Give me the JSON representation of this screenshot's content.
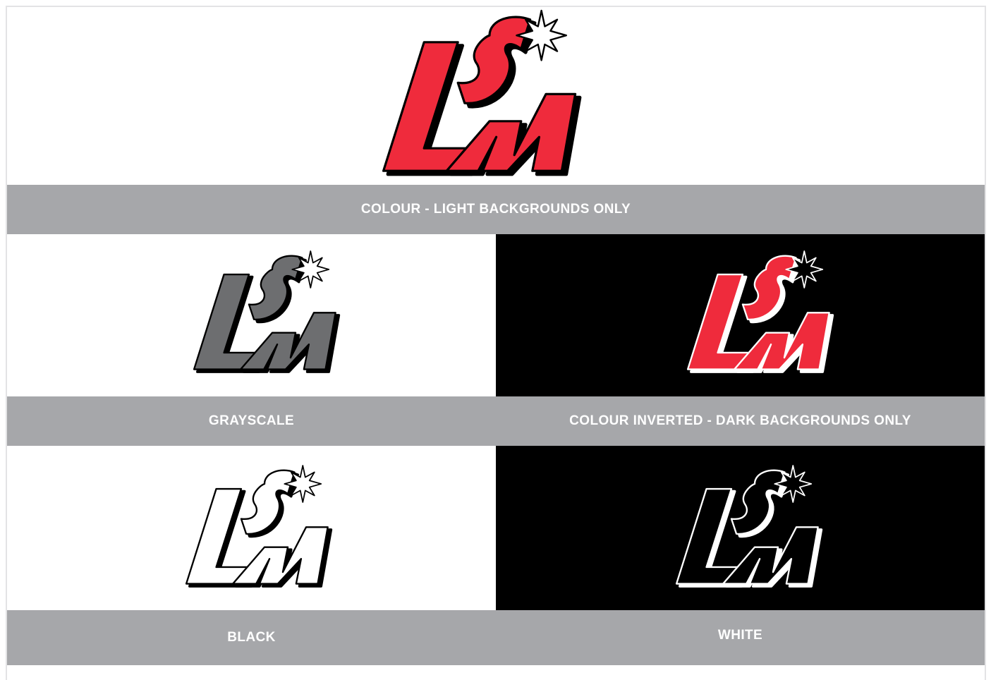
{
  "logo": {
    "text": "LSM"
  },
  "variants": [
    {
      "label": "COLOUR - LIGHT BACKGROUNDS ONLY"
    },
    {
      "label": "GRAYSCALE"
    },
    {
      "label": "COLOUR INVERTED - DARK BACKGROUNDS ONLY"
    },
    {
      "label": "BLACK"
    },
    {
      "label": "WHITE"
    }
  ],
  "colors": {
    "brand_red": "#ef2b3c",
    "gray_fill": "#6d6e70",
    "label_bar": "#a6a7aa",
    "dark_background": "#000000",
    "light_background": "#ffffff"
  }
}
